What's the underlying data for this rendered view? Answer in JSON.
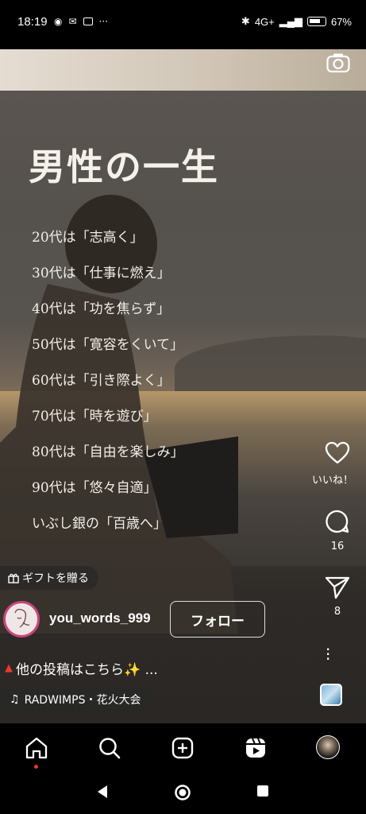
{
  "status_bar": {
    "time": "18:19",
    "network": "4G+",
    "battery": "67%"
  },
  "post": {
    "title": "男性の一生",
    "lines": [
      "20代は「志高く」",
      "30代は「仕事に燃え」",
      "40代は「功を焦らず」",
      "50代は「寛容をくいて」",
      "60代は「引き際よく」",
      "70代は「時を遊び」",
      "80代は「自由を楽しみ」",
      "90代は「悠々自適」",
      "いぶし銀の「百歳へ」"
    ]
  },
  "actions": {
    "like_label": "いいね！",
    "comment_count": "16",
    "share_count": "8"
  },
  "overlay": {
    "gift_label": "ギフトを贈る",
    "username": "you_words_999",
    "follow_label": "フォロー",
    "caption": "他の投稿はこちら✨ ...",
    "music": "RADWIMPS・花火大会"
  },
  "icons": {
    "camera": "camera-icon",
    "heart": "heart-icon",
    "comment": "comment-icon",
    "share": "paper-plane-icon",
    "more": "more-vertical-icon",
    "music": "music-note-icon",
    "gift": "gift-icon",
    "nav": [
      "home-icon",
      "search-icon",
      "create-icon",
      "reels-icon",
      "profile-avatar"
    ]
  },
  "colors": {
    "live_dot": "#e8392b",
    "caption_marker": "#e8392b",
    "avatar_ring": "#c8457a"
  }
}
